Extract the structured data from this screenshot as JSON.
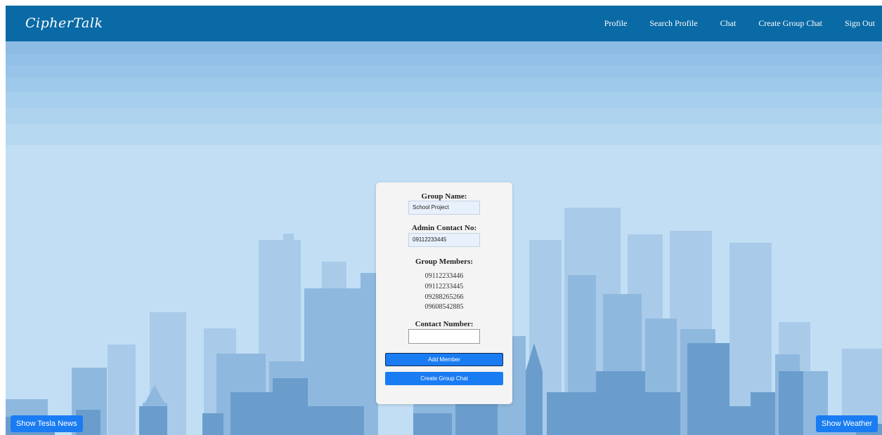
{
  "navbar": {
    "brand": "CipherTalk",
    "links": [
      "Profile",
      "Search Profile",
      "Chat",
      "Create Group Chat",
      "Sign Out"
    ]
  },
  "form": {
    "group_name_label": "Group Name:",
    "group_name_value": "School Project",
    "admin_contact_label": "Admin Contact No:",
    "admin_contact_value": "09112233445",
    "members_label": "Group Members:",
    "members": [
      "09112233446",
      "09112233445",
      "09288265266",
      "09608542885"
    ],
    "contact_number_label": "Contact Number:",
    "contact_number_value": "",
    "add_member_button": "Add Member",
    "create_group_button": "Create Group Chat"
  },
  "footer": {
    "tesla_button": "Show Tesla News",
    "weather_button": "Show Weather"
  },
  "colors": {
    "navbar": "#0a6aa5",
    "button": "#1a7cf2",
    "sky_top": "#8fbee5",
    "sky_bottom": "#c9e2f5"
  }
}
